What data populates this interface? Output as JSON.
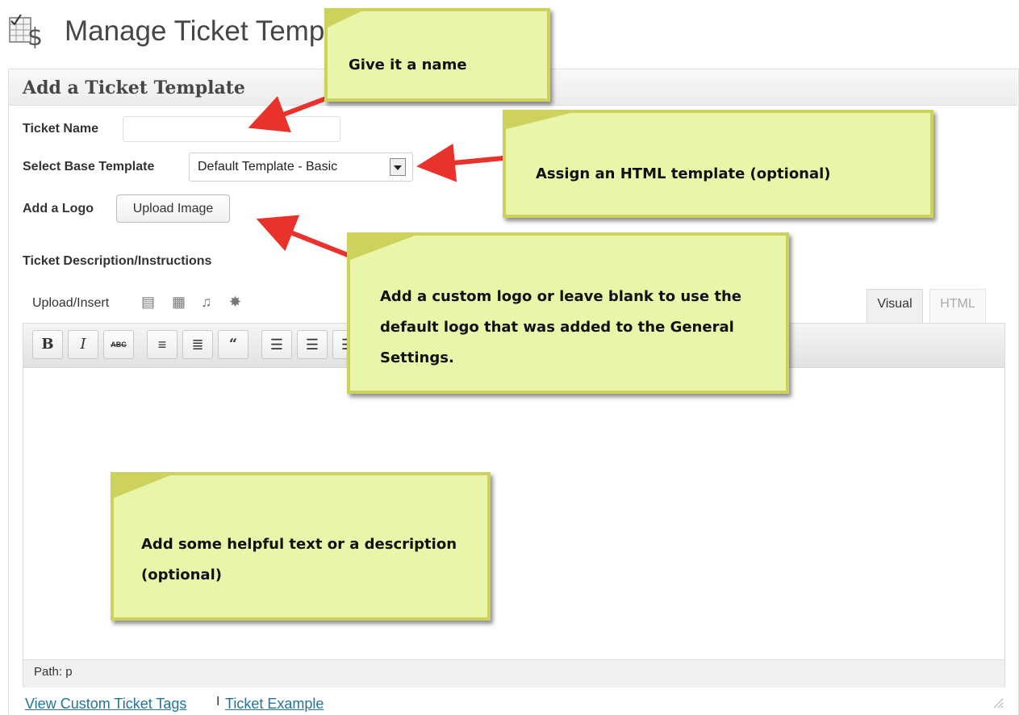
{
  "page": {
    "title": "Manage Ticket Templates",
    "icon": "ticket-pricing-icon"
  },
  "panel": {
    "title": "Add a Ticket Template"
  },
  "form": {
    "ticket_name_label": "Ticket Name",
    "ticket_name_value": "",
    "base_template_label": "Select Base Template",
    "base_template_value": "Default Template - Basic",
    "logo_label": "Add a Logo",
    "upload_button": "Upload Image",
    "description_label": "Ticket Description/Instructions"
  },
  "editor": {
    "upload_insert": "Upload/Insert",
    "media_icons": [
      "add-image-icon",
      "add-video-icon",
      "add-audio-icon",
      "add-media-icon"
    ],
    "tabs": {
      "visual": "Visual",
      "html": "HTML"
    },
    "active_tab": "Visual",
    "toolbar": [
      "B",
      "I",
      "ABC"
    ],
    "toolbar_icons": [
      "bold-icon",
      "italic-icon",
      "strikethrough-icon",
      "bullet-list-icon",
      "numbered-list-icon",
      "blockquote-icon",
      "align-left-icon",
      "align-center-icon",
      "align-right-icon"
    ],
    "path": "Path: p"
  },
  "links": {
    "custom_tags": "View Custom Ticket Tags",
    "separator": "I",
    "example": "Ticket Example"
  },
  "annotations": {
    "name": "Give it a name",
    "template": "Assign an HTML template (optional)",
    "logo": "Add a custom logo or  leave blank to use the default logo that was added to the General Settings.",
    "description": "Add some helpful text or a description (optional)"
  },
  "colors": {
    "note_fill": "#e9f5a8",
    "note_border": "#cdd25d",
    "arrow": "#e8322b",
    "link": "#21759b"
  }
}
